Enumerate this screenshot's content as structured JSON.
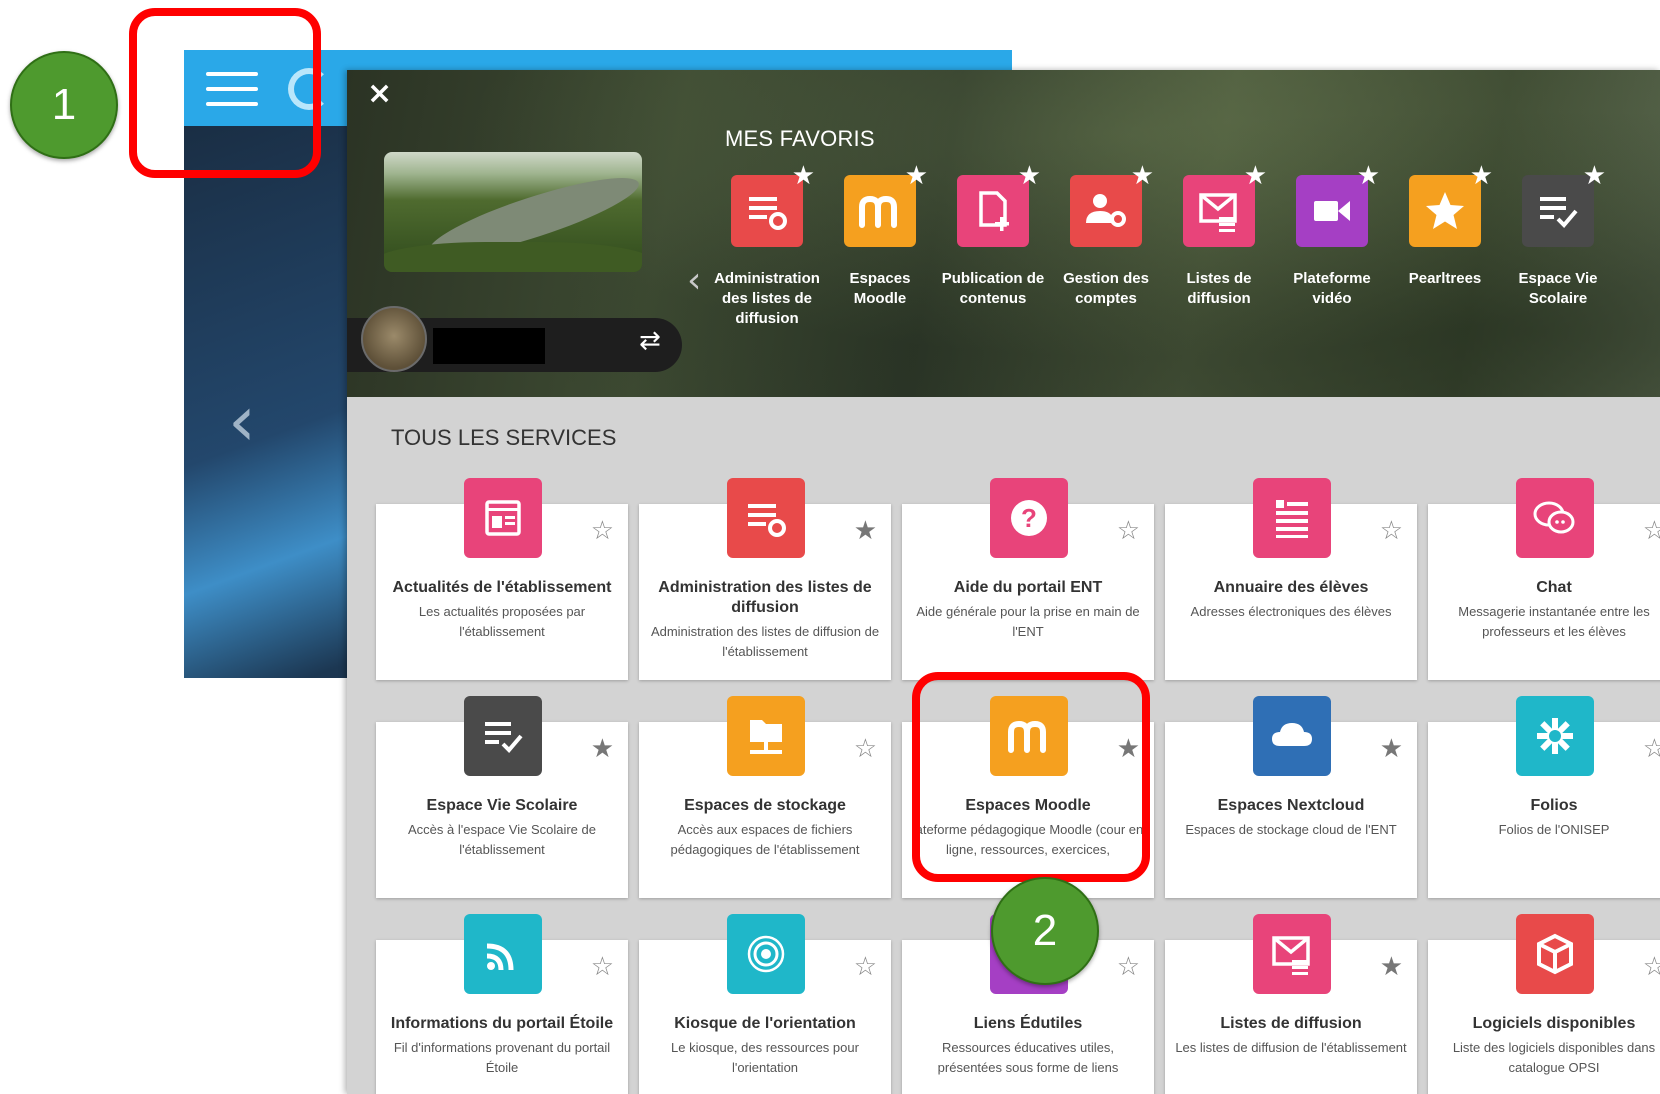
{
  "markers": [
    "1",
    "2"
  ],
  "panel": {
    "close": "×",
    "switch_icon": "⇄",
    "favorites_title": "MES FAVORIS",
    "all_services_title": "TOUS LES SERVICES",
    "prev": "‹"
  },
  "favorites": [
    {
      "label": "Administration des listes de diffusion",
      "color": "#e84a4a",
      "icon": "list-gear-icon"
    },
    {
      "label": "Espaces Moodle",
      "color": "#f5a01f",
      "icon": "moodle-icon"
    },
    {
      "label": "Publication de contenus",
      "color": "#e8447a",
      "icon": "document-plus-icon"
    },
    {
      "label": "Gestion des comptes",
      "color": "#e84a4a",
      "icon": "user-gear-icon"
    },
    {
      "label": "Listes de diffusion",
      "color": "#e8447a",
      "icon": "mail-list-icon"
    },
    {
      "label": "Plateforme vidéo",
      "color": "#a53fc4",
      "icon": "video-camera-icon"
    },
    {
      "label": "Pearltrees",
      "color": "#f5a01f",
      "icon": "star-icon"
    },
    {
      "label": "Espace Vie Scolaire",
      "color": "#4a4a4a",
      "icon": "checklist-icon"
    }
  ],
  "services": [
    {
      "name": "Actualités de l'établissement",
      "desc": "Les actualités proposées par l'établissement",
      "color": "#e8447a",
      "icon": "news-icon",
      "favorite": false
    },
    {
      "name": "Administration des listes de diffusion",
      "desc": "Administration des listes de diffusion de l'établissement",
      "color": "#e84a4a",
      "icon": "list-gear-icon",
      "favorite": true
    },
    {
      "name": "Aide du portail ENT",
      "desc": "Aide générale pour la prise en main de l'ENT",
      "color": "#e8447a",
      "icon": "question-icon",
      "favorite": false
    },
    {
      "name": "Annuaire des élèves",
      "desc": "Adresses électroniques des élèves",
      "color": "#e8447a",
      "icon": "directory-icon",
      "favorite": false
    },
    {
      "name": "Chat",
      "desc": "Messagerie instantanée entre les professeurs et les élèves",
      "color": "#e8447a",
      "icon": "chat-icon",
      "favorite": false
    },
    {
      "name": "Espace Vie Scolaire",
      "desc": "Accès à l'espace Vie Scolaire de l'établissement",
      "color": "#4a4a4a",
      "icon": "checklist-icon",
      "favorite": true
    },
    {
      "name": "Espaces de stockage",
      "desc": "Accès aux espaces de fichiers pédagogiques de l'établissement",
      "color": "#f5a01f",
      "icon": "network-folder-icon",
      "favorite": false
    },
    {
      "name": "Espaces Moodle",
      "desc": "lateforme pédagogique Moodle (cour en ligne, ressources, exercices,",
      "color": "#f5a01f",
      "icon": "moodle-icon",
      "favorite": true
    },
    {
      "name": "Espaces Nextcloud",
      "desc": "Espaces de stockage cloud de l'ENT",
      "color": "#2f6fb5",
      "icon": "cloud-icon",
      "favorite": true
    },
    {
      "name": "Folios",
      "desc": "Folios de l'ONISEP",
      "color": "#1fb7c9",
      "icon": "folios-icon",
      "favorite": false
    },
    {
      "name": "Informations du portail Étoile",
      "desc": "Fil d'informations provenant du portail Étoile",
      "color": "#1fb7c9",
      "icon": "rss-icon",
      "favorite": false
    },
    {
      "name": "Kiosque de l'orientation",
      "desc": "Le kiosque, des ressources pour l'orientation",
      "color": "#1fb7c9",
      "icon": "target-icon",
      "favorite": false
    },
    {
      "name": "Liens Édutiles",
      "desc": "Ressources éducatives utiles, présentées sous forme de liens",
      "color": "#a53fc4",
      "icon": "link-icon",
      "favorite": false
    },
    {
      "name": "Listes de diffusion",
      "desc": "Les listes de diffusion de l'établissement",
      "color": "#e8447a",
      "icon": "mail-list-icon",
      "favorite": true
    },
    {
      "name": "Logiciels disponibles",
      "desc": "Liste des logiciels disponibles dans catalogue OPSI",
      "color": "#e84a4a",
      "icon": "box-icon",
      "favorite": false
    }
  ]
}
